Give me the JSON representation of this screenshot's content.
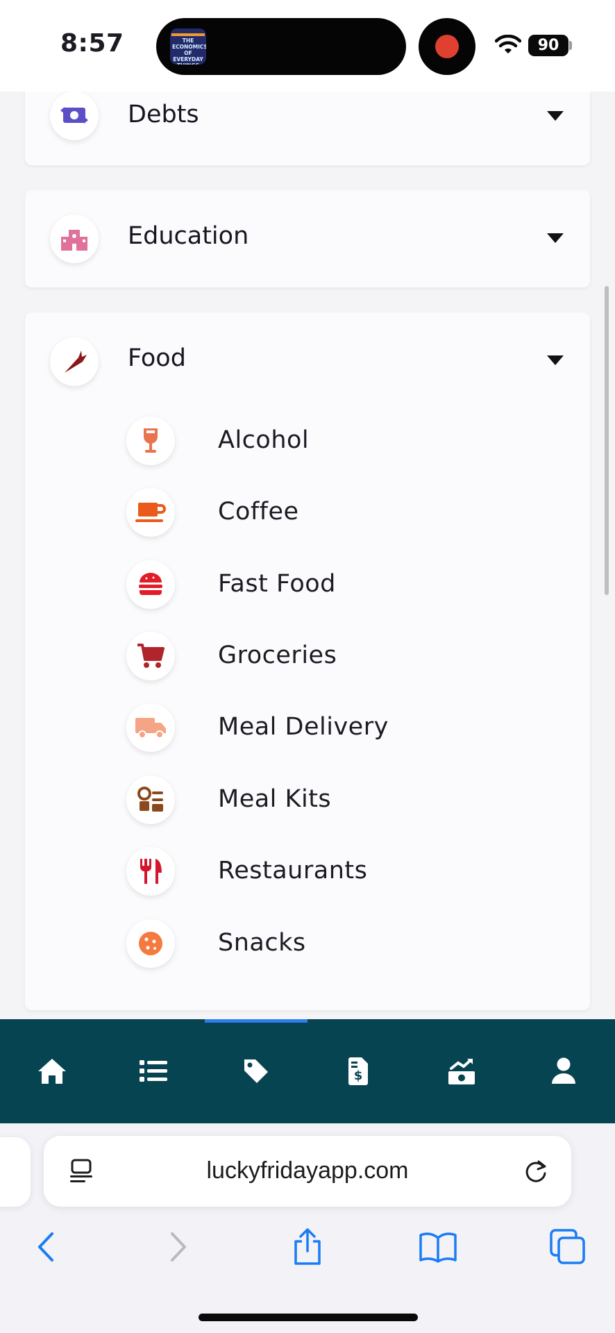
{
  "status_bar": {
    "time": "8:57",
    "battery": "90",
    "island_art_text": "THE ECONOMICS OF EVERYDAY THINGS"
  },
  "categories": [
    {
      "label": "Debts",
      "icon": "money-exchange-icon",
      "icon_color": "#5b4fc7",
      "expanded": false
    },
    {
      "label": "Education",
      "icon": "school-icon",
      "icon_color": "#e0719a",
      "expanded": false
    },
    {
      "label": "Food",
      "icon": "carrot-icon",
      "icon_color": "#8a1616",
      "expanded": true,
      "items": [
        {
          "label": "Alcohol",
          "icon": "wine-glass-icon",
          "icon_color": "#e9734f"
        },
        {
          "label": "Coffee",
          "icon": "coffee-mug-icon",
          "icon_color": "#ea5a1d"
        },
        {
          "label": "Fast Food",
          "icon": "burger-icon",
          "icon_color": "#e11d2a"
        },
        {
          "label": "Groceries",
          "icon": "shopping-cart-icon",
          "icon_color": "#b0242b"
        },
        {
          "label": "Meal Delivery",
          "icon": "delivery-truck-icon",
          "icon_color": "#f5a585"
        },
        {
          "label": "Meal Kits",
          "icon": "meal-kit-icon",
          "icon_color": "#8b4a1e"
        },
        {
          "label": "Restaurants",
          "icon": "fork-knife-icon",
          "icon_color": "#d4172c"
        },
        {
          "label": "Snacks",
          "icon": "cookie-icon",
          "icon_color": "#f47a3f"
        }
      ]
    }
  ],
  "app_nav": {
    "items": [
      "home-icon",
      "list-icon",
      "tag-icon",
      "invoice-icon",
      "money-growth-icon",
      "user-icon"
    ],
    "active_index": 2,
    "background": "#064452"
  },
  "browser": {
    "url": "luckyfridayapp.com",
    "accent": "#1a7cf5"
  }
}
